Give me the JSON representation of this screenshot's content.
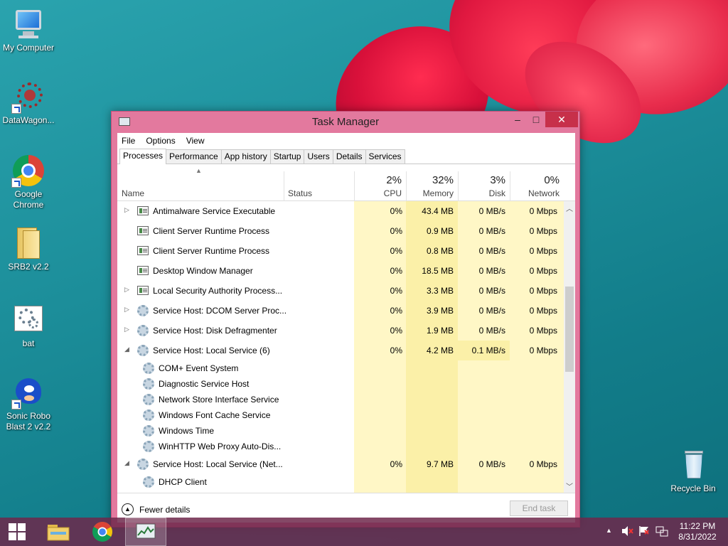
{
  "desktop": {
    "icons": [
      {
        "label": "My Computer"
      },
      {
        "label": "DataWagon..."
      },
      {
        "label": "Google Chrome"
      },
      {
        "label": "SRB2 v2.2"
      },
      {
        "label": "bat"
      },
      {
        "label": "Sonic Robo Blast 2 v2.2"
      },
      {
        "label": "Recycle Bin"
      }
    ]
  },
  "window": {
    "title": "Task Manager",
    "controls": {
      "minimize": "–",
      "maximize": "□",
      "close": "✕"
    },
    "menu": [
      "File",
      "Options",
      "View"
    ],
    "tabs": [
      "Processes",
      "Performance",
      "App history",
      "Startup",
      "Users",
      "Details",
      "Services"
    ],
    "active_tab": "Processes",
    "header": {
      "name": "Name",
      "status": "Status",
      "cpu": {
        "pct": "2%",
        "label": "CPU"
      },
      "memory": {
        "pct": "32%",
        "label": "Memory"
      },
      "disk": {
        "pct": "3%",
        "label": "Disk"
      },
      "network": {
        "pct": "0%",
        "label": "Network"
      }
    },
    "processes": [
      {
        "name": "Antimalware Service Executable",
        "cpu": "0%",
        "memory": "43.4 MB",
        "disk": "0 MB/s",
        "network": "0 Mbps"
      },
      {
        "name": "Client Server Runtime Process",
        "cpu": "0%",
        "memory": "0.9 MB",
        "disk": "0 MB/s",
        "network": "0 Mbps"
      },
      {
        "name": "Client Server Runtime Process",
        "cpu": "0%",
        "memory": "0.8 MB",
        "disk": "0 MB/s",
        "network": "0 Mbps"
      },
      {
        "name": "Desktop Window Manager",
        "cpu": "0%",
        "memory": "18.5 MB",
        "disk": "0 MB/s",
        "network": "0 Mbps"
      },
      {
        "name": "Local Security Authority Process...",
        "cpu": "0%",
        "memory": "3.3 MB",
        "disk": "0 MB/s",
        "network": "0 Mbps"
      },
      {
        "name": "Service Host: DCOM Server Proc...",
        "cpu": "0%",
        "memory": "3.9 MB",
        "disk": "0 MB/s",
        "network": "0 Mbps"
      },
      {
        "name": "Service Host: Disk Defragmenter",
        "cpu": "0%",
        "memory": "1.9 MB",
        "disk": "0 MB/s",
        "network": "0 Mbps"
      },
      {
        "name": "Service Host: Local Service (6)",
        "cpu": "0%",
        "memory": "4.2 MB",
        "disk": "0.1 MB/s",
        "network": "0 Mbps"
      },
      {
        "name": "COM+ Event System"
      },
      {
        "name": "Diagnostic Service Host"
      },
      {
        "name": "Network Store Interface Service"
      },
      {
        "name": "Windows Font Cache Service"
      },
      {
        "name": "Windows Time"
      },
      {
        "name": "WinHTTP Web Proxy Auto-Dis..."
      },
      {
        "name": "Service Host: Local Service (Net...",
        "cpu": "0%",
        "memory": "9.7 MB",
        "disk": "0 MB/s",
        "network": "0 Mbps"
      },
      {
        "name": "DHCP Client"
      }
    ],
    "footer": {
      "fewer_details": "Fewer details",
      "end_task": "End task"
    }
  },
  "taskbar": {
    "time": "11:22 PM",
    "date": "8/31/2022"
  },
  "colors": {
    "window_border": "#e3799e",
    "close_button": "#c7304a",
    "heat_light": "#fff7c6",
    "heat_dark": "#fbf0a8",
    "taskbar": "#6e284b"
  }
}
